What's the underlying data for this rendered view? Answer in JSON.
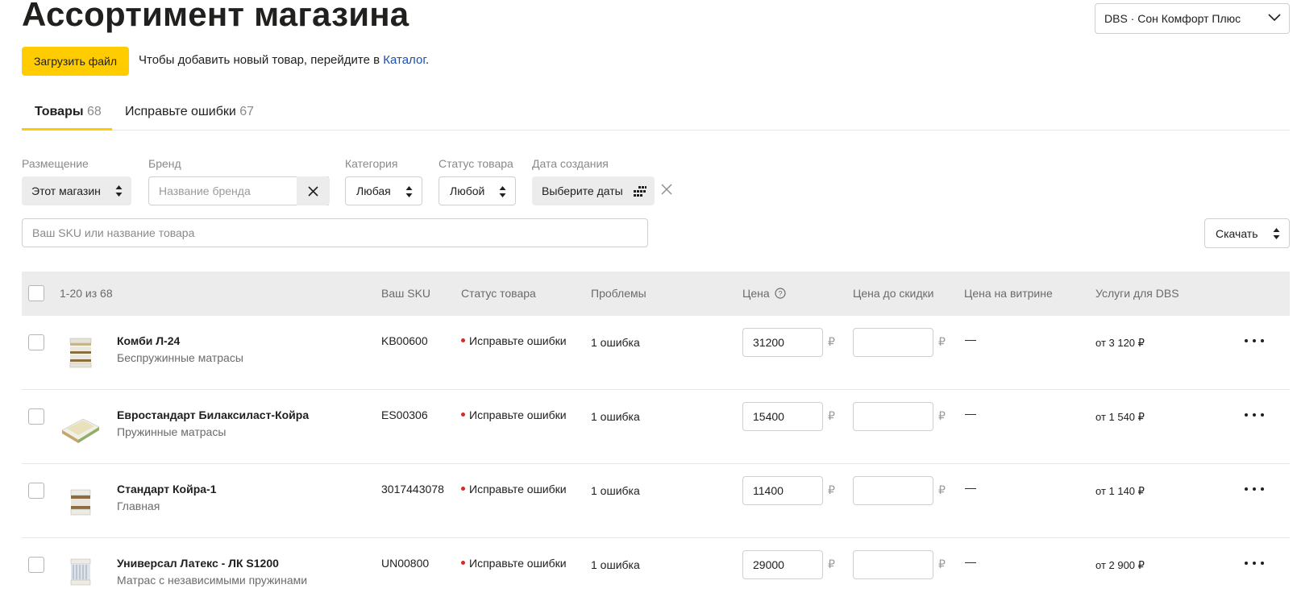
{
  "header": {
    "title": "Ассортимент магазина",
    "shop_select": "DBS · Сон Комфорт Плюс"
  },
  "toolbar": {
    "upload_label": "Загрузить файл",
    "hint_text": "Чтобы добавить новый товар, перейдите в ",
    "hint_link": "Каталог",
    "hint_end": "."
  },
  "tabs": [
    {
      "label": "Товары",
      "count": "68",
      "active": true
    },
    {
      "label": "Исправьте ошибки",
      "count": "67",
      "active": false
    }
  ],
  "filters": {
    "placement": {
      "label": "Размещение",
      "value": "Этот магазин"
    },
    "brand": {
      "label": "Бренд",
      "placeholder": "Название бренда"
    },
    "category": {
      "label": "Категория",
      "value": "Любая"
    },
    "status": {
      "label": "Статус товара",
      "value": "Любой"
    },
    "date": {
      "label": "Дата создания",
      "value": "Выберите даты"
    }
  },
  "search": {
    "placeholder": "Ваш SKU или название товара"
  },
  "download_label": "Скачать",
  "table": {
    "range": "1-20 из 68",
    "columns": {
      "sku": "Ваш SKU",
      "status": "Статус товара",
      "issues": "Проблемы",
      "price": "Цена",
      "old_price": "Цена до скидки",
      "shelf_price": "Цена на витрине",
      "services": "Услуги для DBS"
    },
    "currency": "₽",
    "rows": [
      {
        "name": "Комби Л-24",
        "category": "Беспружинные матрасы",
        "sku": "KB00600",
        "status": "Исправьте ошибки",
        "issues": "1 ошибка",
        "price": "31200",
        "shelf_price": "—",
        "services": "от 3 120 ₽"
      },
      {
        "name": "Евростандарт Билаксиласт-Койра",
        "category": "Пружинные матрасы",
        "sku": "ES00306",
        "status": "Исправьте ошибки",
        "issues": "1 ошибка",
        "price": "15400",
        "shelf_price": "—",
        "services": "от 1 540 ₽"
      },
      {
        "name": "Стандарт Койра-1",
        "category": "Главная",
        "sku": "3017443078",
        "status": "Исправьте ошибки",
        "issues": "1 ошибка",
        "price": "11400",
        "shelf_price": "—",
        "services": "от 1 140 ₽"
      },
      {
        "name": "Универсал Латекс - ЛК S1200",
        "category": "Матрас с независимыми пружинами",
        "sku": "UN00800",
        "status": "Исправьте ошибки",
        "issues": "1 ошибка",
        "price": "29000",
        "shelf_price": "—",
        "services": "от 2 900 ₽"
      }
    ]
  }
}
